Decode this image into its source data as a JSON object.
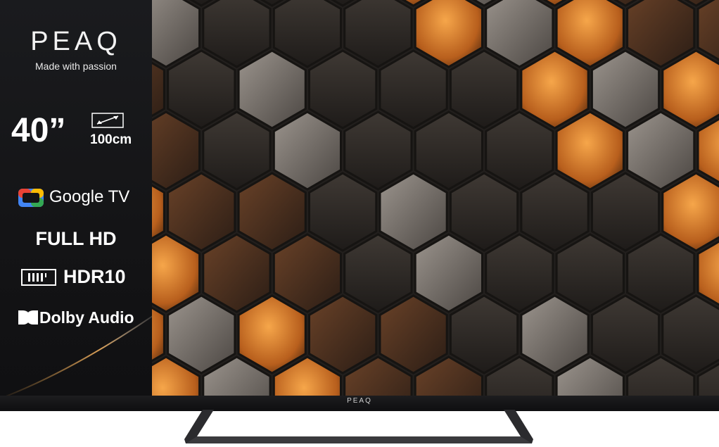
{
  "brand": "PEAQ",
  "tagline": "Made with passion",
  "size": {
    "inches": "40”",
    "cm": "100cm"
  },
  "features": {
    "google_tv": "Google TV",
    "full_hd": "FULL HD",
    "hdr": "HDR10",
    "dolby": "Dolby Audio"
  },
  "bezel_logo": "PEAQ",
  "icons": [
    "diagonal-size-icon",
    "google-tv-icon",
    "hdr-icon",
    "dolby-icon"
  ],
  "colors": {
    "accent": "#e08a3a",
    "bezel": "#141416"
  }
}
